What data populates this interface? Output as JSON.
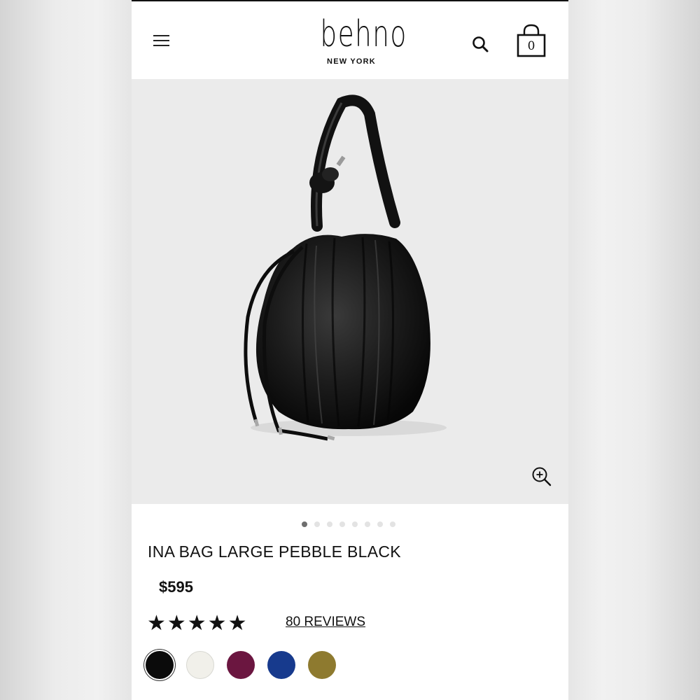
{
  "header": {
    "logo_word": "behno",
    "logo_sub": "NEW YORK",
    "menu_icon": "hamburger-menu-icon",
    "search_icon": "search-icon",
    "cart_icon": "shopping-bag-icon",
    "cart_count": "0"
  },
  "gallery": {
    "image_alt": "Ina Bag Large Pebble Black",
    "zoom_icon": "zoom-in-icon",
    "slide_count": 8,
    "active_slide": 1
  },
  "product": {
    "title": "INA BAG LARGE PEBBLE BLACK",
    "price": "$595",
    "rating": 5,
    "rating_max": 5,
    "stars_text": "★★★★★",
    "reviews_label": "80 REVIEWS"
  },
  "swatches": [
    {
      "color": "#0b0b0b",
      "selected": true
    },
    {
      "color": "#f1f0ea",
      "selected": false
    },
    {
      "color": "#6b1640",
      "selected": false
    },
    {
      "color": "#173a8d",
      "selected": false
    },
    {
      "color": "#8e7a2f",
      "selected": false
    }
  ]
}
